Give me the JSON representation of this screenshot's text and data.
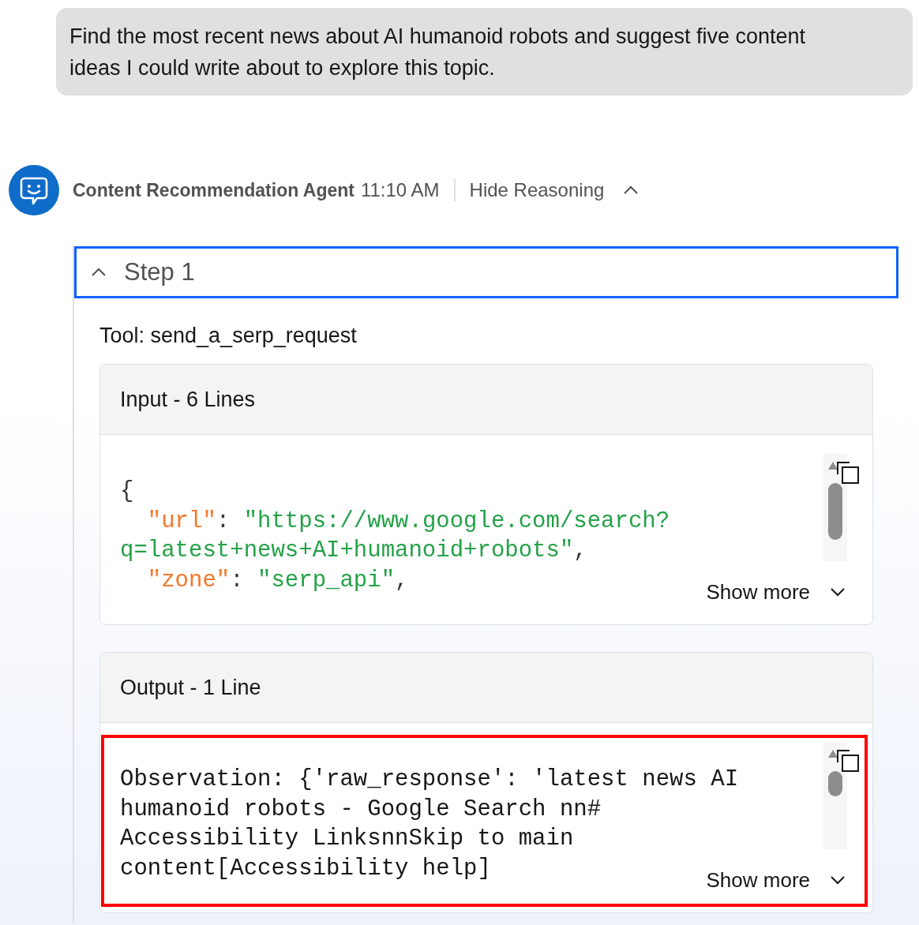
{
  "user_message": {
    "text": "Find the most recent news about AI humanoid robots and suggest five content ideas I could write about to explore this topic."
  },
  "agent": {
    "name": "Content Recommendation Agent",
    "time": "11:10 AM",
    "reasoning_toggle": {
      "label": "Hide Reasoning",
      "expanded": true
    }
  },
  "steps": [
    {
      "title": "Step 1",
      "expanded": true,
      "focused": true,
      "tool_label": "Tool: send_a_serp_request",
      "panels": [
        {
          "kind": "code",
          "title": "Input - 6 Lines",
          "highlighted": false,
          "show_more": "Show more",
          "lines": [
            [
              {
                "text": "{",
                "kind": "punct"
              }
            ],
            [
              {
                "text": "  \"url\"",
                "kind": "key"
              },
              {
                "text": ": ",
                "kind": "punct"
              },
              {
                "text": "\"https://www.google.com/search?",
                "kind": "string"
              }
            ],
            [
              {
                "text": "q=latest+news+AI+humanoid+robots\"",
                "kind": "string"
              },
              {
                "text": ",",
                "kind": "punct"
              }
            ],
            [
              {
                "text": "  \"zone\"",
                "kind": "key"
              },
              {
                "text": ": ",
                "kind": "punct"
              },
              {
                "text": "\"serp_api\"",
                "kind": "string"
              },
              {
                "text": ",",
                "kind": "punct"
              }
            ]
          ]
        },
        {
          "kind": "text",
          "title": "Output - 1 Line",
          "highlighted": true,
          "show_more": "Show more",
          "lines": [
            "Observation: {'raw_response': 'latest news AI",
            "humanoid robots - Google Search nn#",
            "Accessibility LinksnnSkip to main",
            "content[Accessibility help]"
          ]
        }
      ]
    }
  ]
}
